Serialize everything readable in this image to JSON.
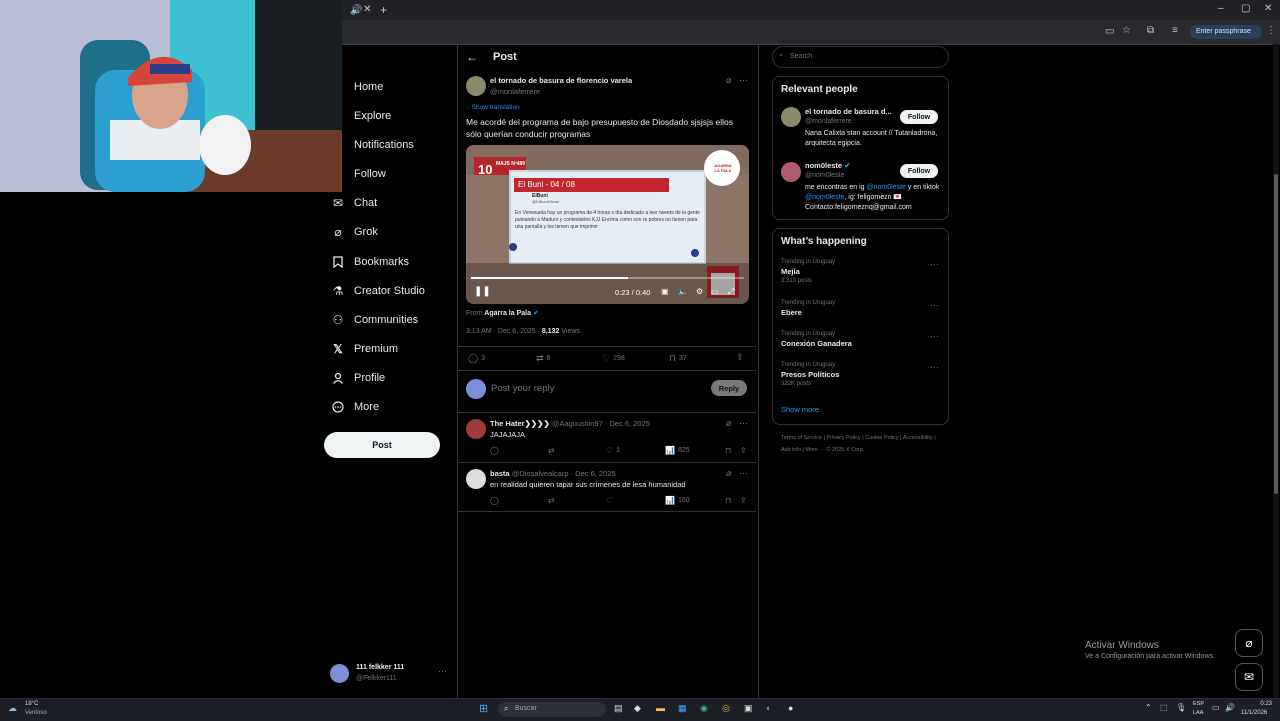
{
  "browser": {
    "passphrase_label": "Enter passphrase"
  },
  "sidebar": {
    "items": [
      {
        "label": "Home",
        "icon": "home-icon"
      },
      {
        "label": "Explore",
        "icon": "search-icon"
      },
      {
        "label": "Notifications",
        "icon": "bell-icon"
      },
      {
        "label": "Follow",
        "icon": "person-icon"
      },
      {
        "label": "Chat",
        "icon": "envelope-icon"
      },
      {
        "label": "Grok",
        "icon": "grok-icon"
      },
      {
        "label": "Bookmarks",
        "icon": "bookmark-icon"
      },
      {
        "label": "Creator Studio",
        "icon": "flask-icon"
      },
      {
        "label": "Communities",
        "icon": "people-icon"
      },
      {
        "label": "Premium",
        "icon": "x-logo-icon"
      },
      {
        "label": "Profile",
        "icon": "person-icon"
      },
      {
        "label": "More",
        "icon": "more-circle-icon"
      }
    ],
    "post_label": "Post",
    "account": {
      "name": "111 felkker 111",
      "handle": "@Felkker111"
    }
  },
  "main": {
    "header_title": "Post",
    "tweet": {
      "author_name": "el tornado de basura de florencio varela",
      "author_handle": "@monlaferrere",
      "show_translation": "Show translation",
      "text": "Me acordé del programa de bajo presupuesto de Diosdado sjsjsjs ellos sólo querían conducir programas",
      "video": {
        "time": "0:23 / 0:40",
        "progress": 0.575,
        "overlay_number": "10",
        "overlay_episode": "MAJS Nº489",
        "card_title": "El Buni - 04 / 08",
        "card_user": "ElBuni",
        "card_handle": "@ElBuniOficial",
        "card_text": "En Venezuela hay un programa de 4 horas x día dedicado a leer tweets de la gente puteando a Maduro y contestarles KJJ Encima como son re pobres no tienen para una pantalla y los tienen que imprimir",
        "logo_text": "AGARRA LA PALA"
      },
      "from_label": "From",
      "from_source": "Agarra la Pala",
      "timestamp": "3:13 AM · Dec 6, 2025 ·",
      "views_count": "8,132",
      "views_label": "Views",
      "replies": "3",
      "reposts": "8",
      "likes": "298",
      "bookmarks": "37"
    },
    "reply_box": {
      "placeholder": "Post your reply",
      "button": "Reply"
    },
    "replies": [
      {
        "name": "The Hater❯❯❯❯",
        "handle": "@Aaguustiin97",
        "date": "· Dec 6, 2025",
        "text": "JAJAJAJA",
        "likes": "1",
        "views": "825"
      },
      {
        "name": "basta",
        "handle": "@Diosalvealcarp",
        "date": "· Dec 6, 2025",
        "text": "en realidad quieren tapar sus crímenes de lesa humanidad",
        "likes": "",
        "views": "160"
      }
    ]
  },
  "right": {
    "search_placeholder": "Search",
    "relevant_title": "Relevant people",
    "people": [
      {
        "name": "el tornado de basura d...",
        "handle": "@monlaferrere",
        "bio": "Nana Calixta stan account // Tutanladrona, arquitecta egipcia.",
        "follow": "Follow"
      },
      {
        "name": "nom0leste",
        "handle": "@nom0leste",
        "bio_pre": "me encontras en ig",
        "bio_link1": "@nom0leste",
        "bio_mid": "y en tiktok",
        "bio_link2": "@nom0leste",
        "bio_post": ", ig: feligomezn 💌 Contacto:feligomeznq@gmail.com",
        "follow": "Follow"
      }
    ],
    "happening_title": "What’s happening",
    "trends": [
      {
        "context": "Trending in Uruguay",
        "name": "Mejía",
        "posts": "3,313 posts"
      },
      {
        "context": "Trending in Uruguay",
        "name": "Ebere",
        "posts": ""
      },
      {
        "context": "Trending in Uruguay",
        "name": "Conexión Ganadera",
        "posts": ""
      },
      {
        "context": "Trending in Uruguay",
        "name": "Presos Políticos",
        "posts": "322K posts"
      }
    ],
    "show_more": "Show more",
    "footer": [
      "Terms of Service",
      "Privacy Policy",
      "Cookie Policy",
      "Accessibility",
      "Ads info",
      "More ···",
      "© 2025 X Corp."
    ]
  },
  "windows": {
    "activate_title": "Activar Windows",
    "activate_sub": "Ve a Configuración para activar Windows."
  },
  "taskbar": {
    "weather_temp": "18°C",
    "weather_desc": "Ventoso",
    "search_placeholder": "Buscar",
    "lang_top": "ESP",
    "lang_bottom": "LAA",
    "time": "0:23",
    "date": "11/1/2026"
  }
}
